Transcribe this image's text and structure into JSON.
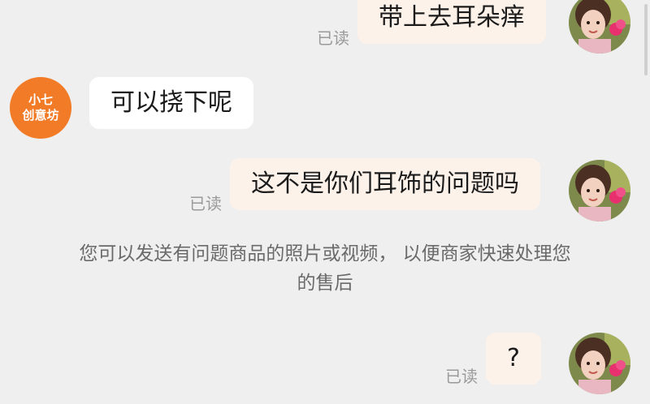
{
  "messages": [
    {
      "text": "带上去耳朵痒",
      "read_label": "已读"
    },
    {
      "text": "可以挠下呢"
    },
    {
      "text": "这不是你们耳饰的问题吗",
      "read_label": "已读"
    },
    {
      "text": "?",
      "read_label": "已读"
    }
  ],
  "shop_avatar": {
    "line1": "小七",
    "line2": "创意坊"
  },
  "system_notice": {
    "line1": "您可以发送有问题商品的照片或视频， 以便商家快速处理您",
    "line2": "的售后"
  },
  "icons": {
    "user_avatar": "user-avatar-photo-icon",
    "shop_avatar": "shop-avatar-icon"
  },
  "colors": {
    "background": "#efefef",
    "outgoing_bubble": "#fdf2ea",
    "incoming_bubble": "#ffffff",
    "shop_avatar_bg": "#f27b27",
    "read_tag": "#9a9a9a",
    "notice_text": "#6a6a6a"
  }
}
